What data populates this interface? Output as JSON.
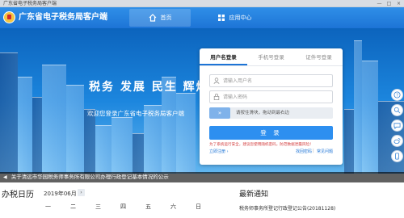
{
  "window": {
    "title": "广东省电子税务局客户端",
    "controls": [
      "—",
      "□",
      "×"
    ]
  },
  "header": {
    "brand": "广东省电子税务局客户端",
    "tabs": [
      {
        "label": "首页",
        "icon": "home-icon",
        "active": true
      },
      {
        "label": "应用中心",
        "icon": "grid-icon",
        "active": false
      }
    ]
  },
  "hero": {
    "slogan": "税务 发展 民生 辉煌",
    "welcome": "欢迎您登录广东省电子税务局客户端"
  },
  "login": {
    "tabs": [
      {
        "label": "用户名登录",
        "active": true
      },
      {
        "label": "手机号登录",
        "active": false
      },
      {
        "label": "证件号登录",
        "active": false
      }
    ],
    "username_placeholder": "请输入用户名",
    "password_placeholder": "请输入密码",
    "slider_knob": "»",
    "slider_text": "请按住滑块，拖动到最右边",
    "submit": "登 录",
    "warning": "为了系统运行安全，建议您使用随机密码，防范数据泄露风险！",
    "link_register": "立即注册 ›",
    "link_forgot": "找回密码",
    "link_sep": "|",
    "link_help": "常见问题"
  },
  "notice": {
    "speaker_icon": "speaker-icon",
    "text": "关于清远市华园税务师事务所有限公司办理行政登记基本情况的公示"
  },
  "calendar": {
    "title": "办税日历",
    "month": "2019年06月",
    "arrow": "›",
    "weekdays": [
      "一",
      "二",
      "三",
      "四",
      "五",
      "六",
      "日"
    ]
  },
  "news": {
    "title": "最新通知",
    "items": [
      "税务师事务所登记行政登记公告(20181128)"
    ]
  },
  "colors": {
    "primary": "#1d74d6",
    "button": "#2d8ff0",
    "warning": "#d23a3a"
  }
}
